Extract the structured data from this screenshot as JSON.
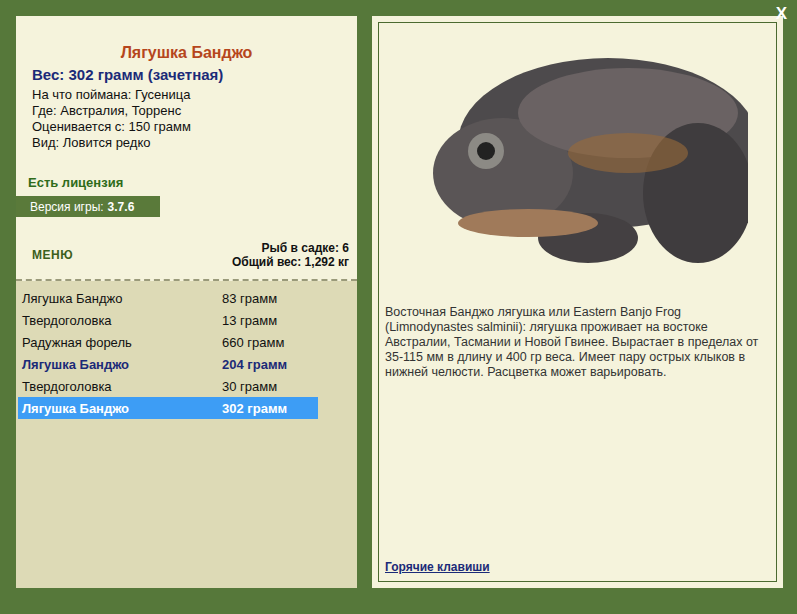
{
  "window": {
    "close": "X"
  },
  "fish": {
    "title": "Лягушка Банджо",
    "weight": "Вес: 302 грамм (зачетная)",
    "details": [
      "На что поймана: Гусеница",
      "Где: Австралия, Торренс",
      "Оценивается с: 150 грамм",
      "Вид: Ловится редко"
    ],
    "license": "Есть лицензия"
  },
  "version": {
    "label": "Версия игры:",
    "value": "3.7.6"
  },
  "menu": "МЕНЮ",
  "keepnet": {
    "count": "Рыб в садке: 6",
    "total": "Общий вес: 1,292 кг"
  },
  "catches": [
    {
      "name": "Лягушка Банджо",
      "weight": "83 грамм",
      "trophy": false,
      "selected": false
    },
    {
      "name": "Твердоголовка",
      "weight": "13 грамм",
      "trophy": false,
      "selected": false
    },
    {
      "name": "Радужная форель",
      "weight": "660 грамм",
      "trophy": false,
      "selected": false
    },
    {
      "name": "Лягушка Банджо",
      "weight": "204 грамм",
      "trophy": true,
      "selected": false
    },
    {
      "name": "Твердоголовка",
      "weight": "30 грамм",
      "trophy": false,
      "selected": false
    },
    {
      "name": "Лягушка Банджо",
      "weight": "302 грамм",
      "trophy": true,
      "selected": true
    }
  ],
  "description": "Восточная Банджо лягушка или Eastern Banjo Frog (Limnodynastes salminii): лягушка проживает на востоке Австралии, Тасмании и Новой Гвинее. Вырастает в пределах от 35-115 мм в длину и 400 гр веса. Имеет пару острых клыков в нижней челюсти. Расцветка может варьировать.",
  "hotkeys": "Горячие клавиши"
}
